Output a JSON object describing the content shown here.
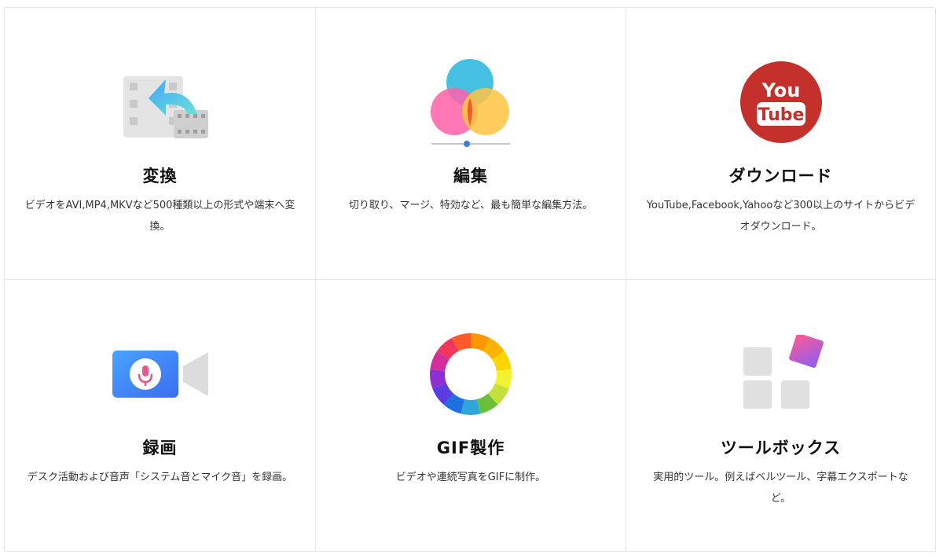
{
  "features": [
    {
      "title": "変換",
      "desc": "ビデオをAVI,MP4,MKVなど500種類以上の形式や端末へ変換。",
      "icon": "convert-video-icon"
    },
    {
      "title": "編集",
      "desc": "切り取り、マージ、特効など、最も簡単な編集方法。",
      "icon": "color-edit-icon"
    },
    {
      "title": "ダウンロード",
      "desc": "YouTube,Facebook,Yahooなど300以上のサイトからビデオダウンロード。",
      "icon": "youtube-icon",
      "icon_text_top": "You",
      "icon_text_bottom": "Tube"
    },
    {
      "title": "録画",
      "desc": "デスク活動および音声「システム音とマイク音」を録画。",
      "icon": "record-camera-icon"
    },
    {
      "title": "GIF製作",
      "desc": "ビデオや連続写真をGIFに制作。",
      "icon": "gif-color-wheel-icon"
    },
    {
      "title": "ツールボックス",
      "desc": "実用的ツール。例えばベルツール、字幕エクスポートなど。",
      "icon": "toolbox-icon"
    }
  ],
  "colors": {
    "youtube_red": "#c4302b",
    "record_blue": "#3b82f6",
    "mic_pink": "#e45b8a"
  }
}
